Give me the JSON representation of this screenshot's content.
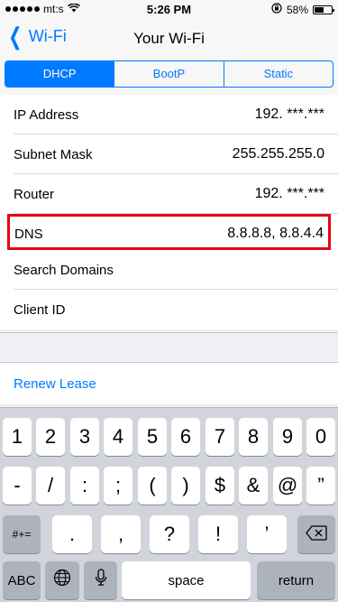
{
  "status": {
    "carrier": "mt:s",
    "time": "5:26 PM",
    "battery": "58%"
  },
  "nav": {
    "back_label": "Wi-Fi",
    "title": "Your Wi-Fi"
  },
  "segments": {
    "dhcp": "DHCP",
    "bootp": "BootP",
    "static": "Static"
  },
  "rows": {
    "ip_label": "IP Address",
    "ip_value": "192. ***.***",
    "mask_label": "Subnet Mask",
    "mask_value": "255.255.255.0",
    "router_label": "Router",
    "router_value": "192.   ***.***",
    "dns_label": "DNS",
    "dns_value": "8.8.8.8, 8.8.4.4",
    "search_label": "Search Domains",
    "client_label": "Client ID"
  },
  "renew_label": "Renew Lease",
  "keyboard": {
    "row1": [
      "1",
      "2",
      "3",
      "4",
      "5",
      "6",
      "7",
      "8",
      "9",
      "0"
    ],
    "row2": [
      "-",
      "/",
      ":",
      ";",
      "(",
      ")",
      "$",
      "&",
      "@",
      "”"
    ],
    "row3": [
      ".",
      ",",
      "?",
      "!",
      "’"
    ],
    "more_symbols": "#+=",
    "abc": "ABC",
    "space": "space",
    "return": "return"
  }
}
